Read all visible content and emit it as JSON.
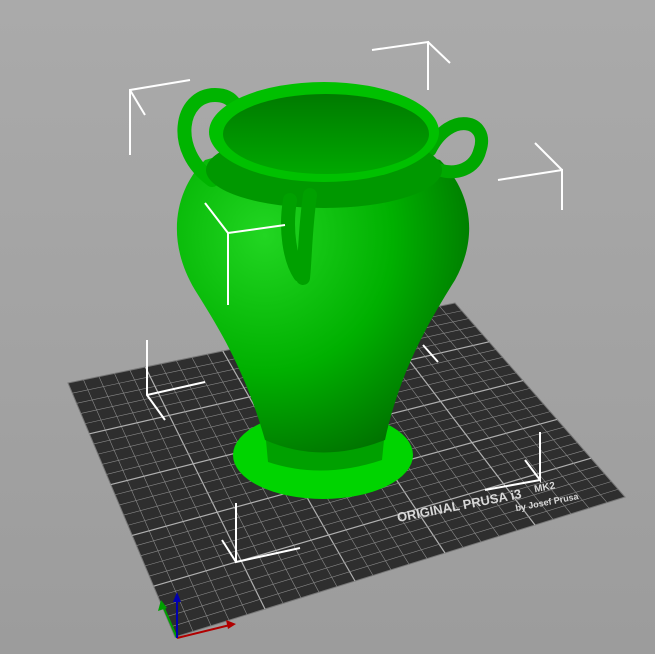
{
  "viewport": {
    "background": "#a5a5a5",
    "bed": {
      "logo_brand": "ORIGINAL PRUSA i3",
      "logo_model": "MK2",
      "logo_author": "by Josef Prusa",
      "surface_color": "#2e2e2e",
      "grid_color": "#8a8a8a",
      "divisions": 25,
      "major_every": 5
    },
    "object": {
      "name_icon": "vase-model",
      "color": "#00b800",
      "selected": true
    },
    "axes": {
      "x_color": "#b00000",
      "y_color": "#00a000",
      "z_color": "#0000b0"
    }
  }
}
